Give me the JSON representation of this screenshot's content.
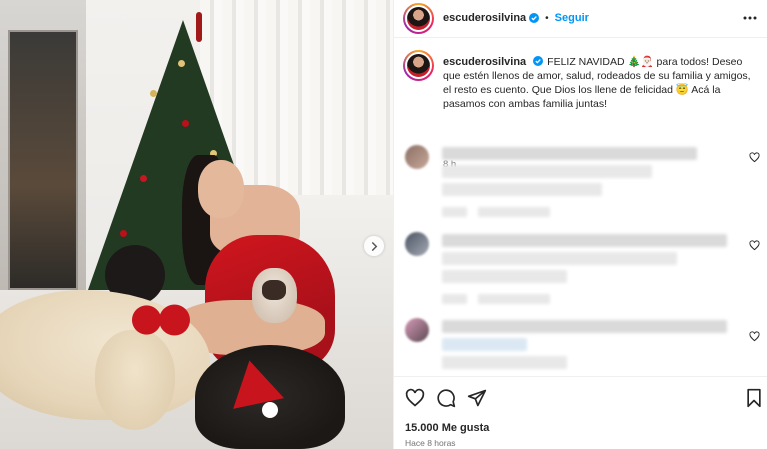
{
  "post": {
    "username": "escuderosilvina",
    "follow_label": "Seguir",
    "separator": "•",
    "caption_username": "escuderosilvina",
    "caption_text": "FELIZ NAVIDAD 🎄🎅🏻 para todos! Deseo que estén llenos de amor, salud, rodeados de su familia y amigos, el resto es cuento. Que Dios los llene de felicidad 😇 Acá la pasamos con ambas familia juntas!",
    "caption_time": "8 h",
    "likes": "15.000 Me gusta",
    "posted_ago": "Hace 8 horas"
  },
  "colors": {
    "accent": "#0095f6",
    "text": "#262626",
    "muted": "#737373",
    "dress_red": "#c8141c"
  },
  "icons": {
    "more": "more-horizontal-icon",
    "verified": "verified-badge-icon",
    "next": "chevron-right-icon",
    "like": "heart-icon",
    "comment": "comment-icon",
    "share": "paper-plane-icon",
    "save": "bookmark-icon"
  }
}
